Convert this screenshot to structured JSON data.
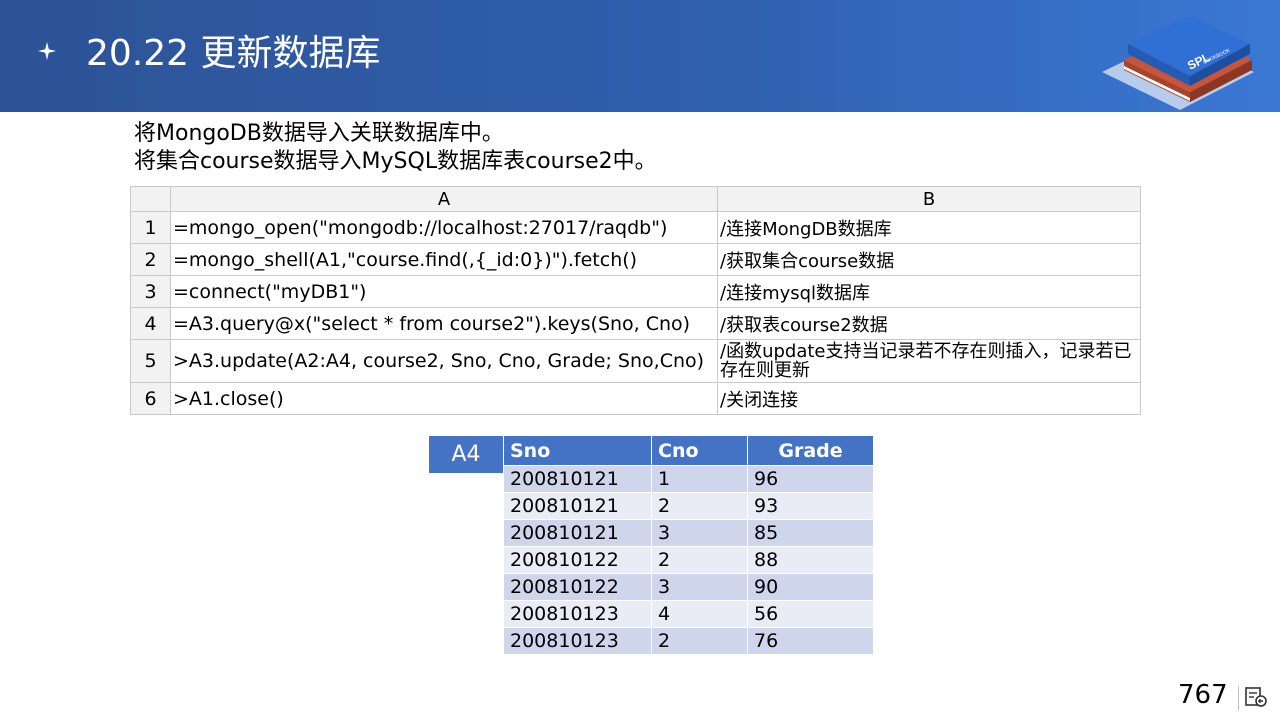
{
  "slide": {
    "title": "20.22 更新数据库",
    "description": [
      "将MongoDB数据导入关联数据库中。",
      "将集合course数据导入MySQL数据库表course2中。"
    ],
    "page_number": "767",
    "logo_text": [
      "SPL",
      "COOKBOOK"
    ]
  },
  "grid": {
    "col_headers": [
      "A",
      "B"
    ],
    "rows": [
      {
        "num": "1",
        "a": "=mongo_open(\"mongodb://localhost:27017/raqdb\")",
        "b": "/连接MongDB数据库"
      },
      {
        "num": "2",
        "a": "=mongo_shell(A1,\"course.find(,{_id:0})\").fetch()",
        "b": "/获取集合course数据"
      },
      {
        "num": "3",
        "a": "=connect(\"myDB1\")",
        "b": "/连接mysql数据库"
      },
      {
        "num": "4",
        "a": "=A3.query@x(\"select  * from course2\").keys(Sno, Cno)",
        "b": "/获取表course2数据"
      },
      {
        "num": "5",
        "a": ">A3.update(A2:A4,  course2, Sno, Cno, Grade;  Sno,Cno)",
        "b": "/函数update支持当记录若不存在则插入，记录若已存在则更新"
      },
      {
        "num": "6",
        "a": ">A1.close()",
        "b": "/关闭连接"
      }
    ]
  },
  "result": {
    "label": "A4",
    "headers": [
      "Sno",
      "Cno",
      "Grade"
    ],
    "rows": [
      [
        "200810121",
        "1",
        "96"
      ],
      [
        "200810121",
        "2",
        "93"
      ],
      [
        "200810121",
        "3",
        "85"
      ],
      [
        "200810122",
        "2",
        "88"
      ],
      [
        "200810122",
        "3",
        "90"
      ],
      [
        "200810123",
        "4",
        "56"
      ],
      [
        "200810123",
        "2",
        "76"
      ]
    ]
  },
  "colors": {
    "header_bg": "#2f5fae",
    "table_header": "#4472c4",
    "row_odd": "#cfd5ea",
    "row_even": "#e9ebf5"
  },
  "icons": {
    "bullet": "four-point-star-icon",
    "logo": "spl-cookbook-book-icon",
    "nav": "slide-navigation-icon"
  }
}
